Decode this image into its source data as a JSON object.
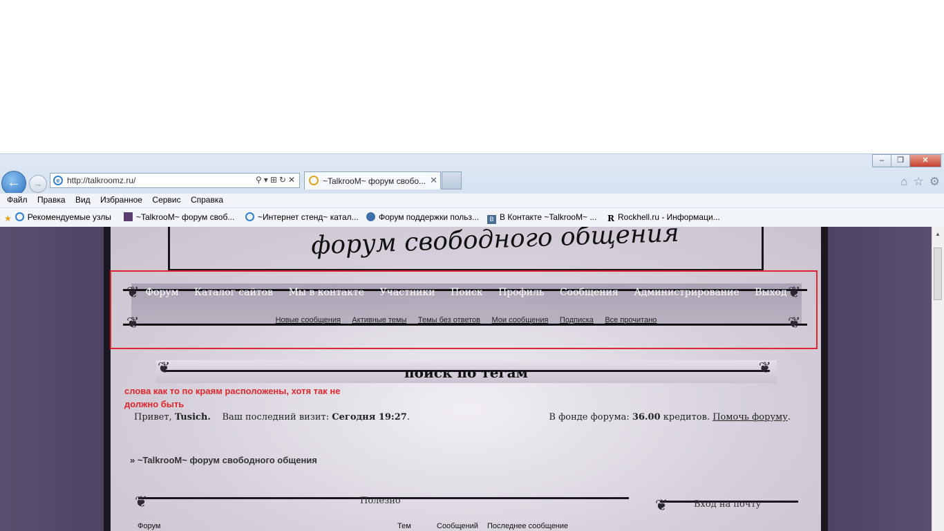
{
  "browser": {
    "address_url": "http://talkroomz.ru/",
    "tab_title": "~TalkrooM~ форум свобо...",
    "menu": [
      "Файл",
      "Правка",
      "Вид",
      "Избранное",
      "Сервис",
      "Справка"
    ],
    "favorites": [
      "Рекомендуемые узлы",
      "~TalkrooM~ форум своб...",
      "~Интернет стенд~ катал...",
      "Форум поддержки польз...",
      "В Контакте  ~TalkrooM~ ...",
      "Rockhell.ru - Информаци..."
    ],
    "colors": {
      "chrome_bg": "#dfe9f5",
      "close_btn": "#c6402c"
    }
  },
  "forum": {
    "logo_text": "форум свободного общения",
    "main_nav": [
      "Форум",
      "Каталог сайтов",
      "Мы в контакте",
      "Участники",
      "Поиск",
      "Профиль",
      "Сообщения",
      "Администрирование",
      "Выход"
    ],
    "sub_nav": [
      "Новые сообщения",
      "Активные темы",
      "Темы без ответов",
      "Мои сообщения",
      "Подписка",
      "Все прочитано"
    ],
    "tag_search_title": "поиск по тегам",
    "annotation": "слова как то по краям расположены, хотя так не должно быть",
    "greeting": {
      "prefix": "Привет,",
      "user": "Tusich.",
      "last_visit_label": "Ваш последний визит:",
      "last_visit_value": "Сегодня 19:27",
      "suffix": "."
    },
    "fund": {
      "label": "В фонде форума:",
      "amount": "36.00",
      "unit": "кредитов.",
      "help_link": "Помочь форуму",
      "suffix": "."
    },
    "breadcrumb": "» ~TalkrooM~ форум свободного общения",
    "section_useful": "Полезно",
    "section_mail": "Вход на почту",
    "table_headers": {
      "forum": "Форум",
      "topics": "Тем",
      "posts": "Сообщений",
      "last_post": "Последнее сообщение"
    },
    "colors": {
      "annotation_red": "#e0262c",
      "side_purple": "#5a4f6e"
    }
  }
}
